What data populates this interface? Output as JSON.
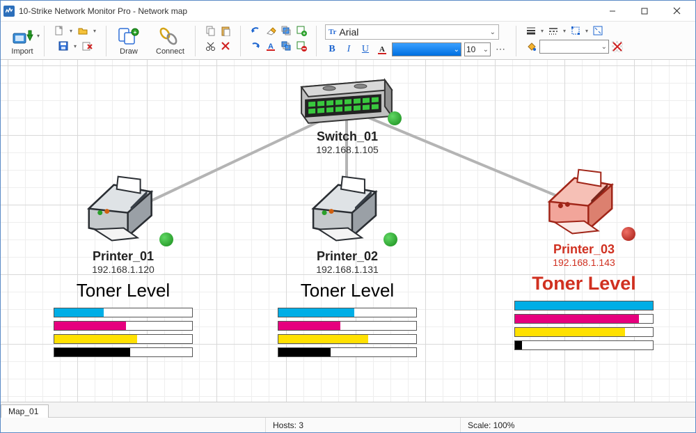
{
  "window": {
    "title": "10-Strike Network Monitor Pro - Network map"
  },
  "toolbar": {
    "import_label": "Import",
    "draw_label": "Draw",
    "connect_label": "Connect",
    "font_name": "Arial",
    "font_size": "10",
    "font_color": "#006fe0",
    "fill_color": "#ffffff"
  },
  "map": {
    "switch": {
      "name": "Switch_01",
      "ip": "192.168.1.105",
      "status": "up"
    },
    "printers": [
      {
        "name": "Printer_01",
        "ip": "192.168.1.120",
        "status": "up",
        "toner_heading": "Toner Level",
        "toner": {
          "cyan": 36,
          "magenta": 52,
          "yellow": 60,
          "black": 55
        }
      },
      {
        "name": "Printer_02",
        "ip": "192.168.1.131",
        "status": "up",
        "toner_heading": "Toner Level",
        "toner": {
          "cyan": 55,
          "magenta": 45,
          "yellow": 65,
          "black": 38
        }
      },
      {
        "name": "Printer_03",
        "ip": "192.168.1.143",
        "status": "down",
        "toner_heading": "Toner Level",
        "toner": {
          "cyan": 100,
          "magenta": 90,
          "yellow": 80,
          "black": 5
        }
      }
    ]
  },
  "tabs": [
    {
      "label": "Map_01"
    }
  ],
  "statusbar": {
    "hosts_label": "Hosts: 3",
    "scale_label": "Scale: 100%"
  }
}
